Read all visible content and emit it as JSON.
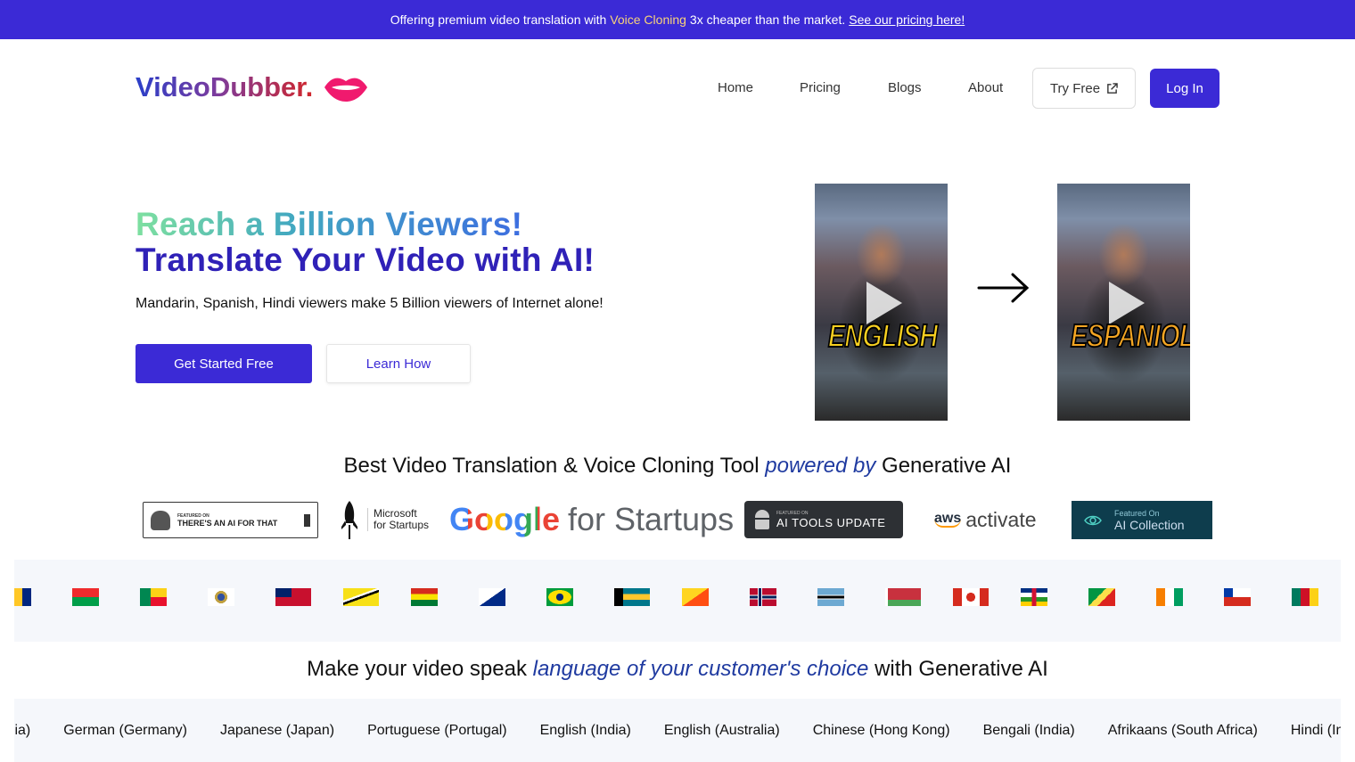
{
  "banner": {
    "text_before": "Offering premium video translation with",
    "highlight": "Voice Cloning",
    "text_after": "3x cheaper than the market.",
    "link": "See our pricing here!"
  },
  "header": {
    "logo": "VideoDubber.",
    "logo_icon": "lips-icon",
    "nav": [
      "Home",
      "Pricing",
      "Blogs",
      "About"
    ],
    "try_free": "Try Free",
    "login": "Log In"
  },
  "hero": {
    "headline_1": "Reach a Billion Viewers!",
    "headline_2": "Translate Your Video with AI!",
    "subtitle": "Mandarin, Spanish, Hindi viewers make 5 Billion viewers of Internet alone!",
    "cta_primary": "Get Started Free",
    "cta_secondary": "Learn How",
    "video_before_caption": "ENGLISH",
    "video_after_caption": "ESPANIOL"
  },
  "partners_heading": {
    "before": "Best Video Translation & Voice Cloning Tool",
    "italic": "powered by",
    "after": "Generative AI"
  },
  "partners": {
    "taaft": {
      "small": "FEATURED ON",
      "big": "THERE'S AN AI FOR THAT"
    },
    "microsoft": {
      "line1": "Microsoft",
      "line2": "for Startups"
    },
    "google": {
      "brand": "Google",
      "suffix": "for Startups"
    },
    "aitools": {
      "small": "FEATURED ON",
      "big": "AI TOOLS UPDATE"
    },
    "aws": {
      "brand": "aws",
      "suffix": "activate"
    },
    "aicollection": {
      "small": "Featured On",
      "big": "AI Collection"
    }
  },
  "flags": [
    "barbados",
    "burkina-faso",
    "benin",
    "saint-barthelemy",
    "bermuda",
    "brunei",
    "bolivia",
    "bonaire",
    "brazil",
    "bahamas",
    "bhutan",
    "norway",
    "botswana",
    "belarus",
    "canada",
    "central-african-republic",
    "congo",
    "ivory-coast",
    "chile",
    "cameroon"
  ],
  "languages_heading": {
    "before": "Make your video speak",
    "italic": "language of your customer's choice",
    "after": "with Generative AI"
  },
  "languages": [
    "Hindi (India)",
    "German (Germany)",
    "Japanese (Japan)",
    "Portuguese (Portugal)",
    "English (India)",
    "English (Australia)",
    "Chinese (Hong Kong)",
    "Bengali (India)",
    "Afrikaans (South Africa)",
    "Hindi (India)"
  ],
  "colors": {
    "brand": "#3b2ad6",
    "headline": "#2f21b7",
    "highlight": "#f8d37a"
  }
}
